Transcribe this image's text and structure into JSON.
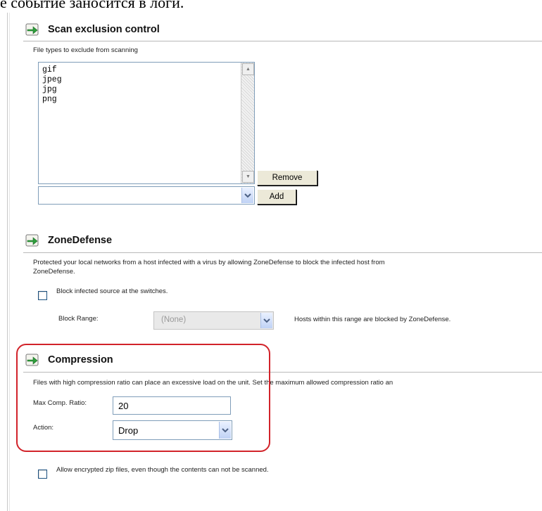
{
  "top_text": "е событие заносится в логи.",
  "scan_exclusion": {
    "title": "Scan exclusion control",
    "label": "File types to exclude from scanning",
    "file_types": [
      "gif",
      "jpeg",
      "jpg",
      "png"
    ],
    "new_type_value": "",
    "remove_button": "Remove",
    "add_button": "Add"
  },
  "zonedefense": {
    "title": "ZoneDefense",
    "description_line1": "Protected your local networks from a host infected with a virus by allowing ZoneDefense to block the infected host from",
    "description_line2": "ZoneDefense.",
    "checkbox_label": "Block infected source at the switches.",
    "checkbox_checked": false,
    "block_range_label": "Block Range:",
    "block_range_value": "(None)",
    "block_range_hint": "Hosts within this range are blocked by ZoneDefense."
  },
  "compression": {
    "title": "Compression",
    "description": "Files with high compression ratio can place an excessive load on the unit. Set the maximum allowed compression ratio an",
    "max_ratio_label": "Max Comp. Ratio:",
    "max_ratio_value": "20",
    "action_label": "Action:",
    "action_value": "Drop"
  },
  "encrypted": {
    "checkbox_label": "Allow encrypted zip files, even though the contents can not be scanned.",
    "checkbox_checked": false
  },
  "colors": {
    "highlight_frame": "#d2232a",
    "field_border": "#7f9db9",
    "icon_green": "#2e9e3c"
  }
}
